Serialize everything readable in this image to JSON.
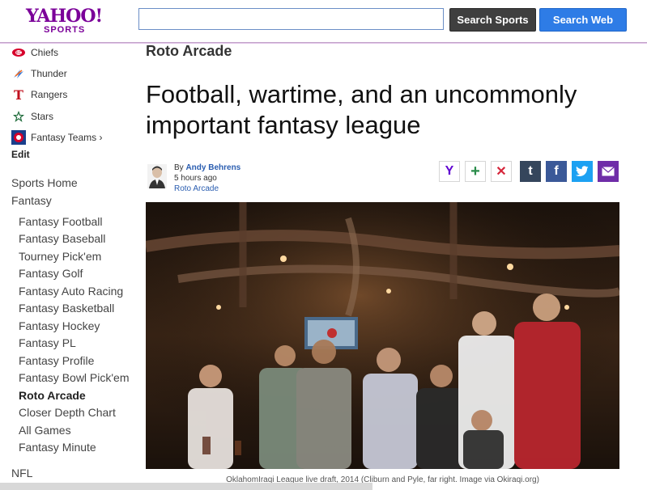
{
  "header": {
    "logo_main": "YAHOO!",
    "logo_sub": "SPORTS",
    "search_value": "",
    "search_sports_label": "Search Sports",
    "search_web_label": "Search Web"
  },
  "sidebar": {
    "teams": [
      {
        "label": "Chiefs",
        "icon": "chiefs-logo-icon"
      },
      {
        "label": "Thunder",
        "icon": "thunder-logo-icon"
      },
      {
        "label": "Rangers",
        "icon": "rangers-logo-icon"
      },
      {
        "label": "Stars",
        "icon": "stars-logo-icon"
      },
      {
        "label": "Fantasy Teams ›",
        "icon": "fantasy-teams-icon"
      }
    ],
    "edit_label": "Edit",
    "sports_home": "Sports Home",
    "fantasy": "Fantasy",
    "fantasy_items": [
      "Fantasy Football",
      "Fantasy Baseball",
      "Tourney Pick'em",
      "Fantasy Golf",
      "Fantasy Auto Racing",
      "Fantasy Basketball",
      "Fantasy Hockey",
      "Fantasy PL",
      "Fantasy Profile",
      "Fantasy Bowl Pick'em",
      "Roto Arcade",
      "Closer Depth Chart",
      "All Games",
      "Fantasy Minute"
    ],
    "active_item": "Roto Arcade",
    "nfl": "NFL"
  },
  "article": {
    "section": "Roto Arcade",
    "headline": "Football, wartime, and an uncommonly important fantasy league",
    "by": "By",
    "author": "Andy Behrens",
    "time": "5 hours ago",
    "byline_section": "Roto Arcade",
    "caption": "OklahomIraqi League live draft, 2014 (Cliburn and Pyle, far right. Image via Okiraqi.org)"
  },
  "share": {
    "yahoo": "Y",
    "plus": "+",
    "close": "✕",
    "tumblr": "t",
    "facebook": "f",
    "twitter": "➔",
    "mail": "✉"
  },
  "colors": {
    "brand": "#7b0099",
    "search_sports": "#3f3f3f",
    "search_web": "#2e7ce6",
    "link": "#2a5db0",
    "tumblr": "#35465c",
    "facebook": "#3b5998",
    "twitter": "#1da1f2",
    "mail": "#6f2da8"
  }
}
